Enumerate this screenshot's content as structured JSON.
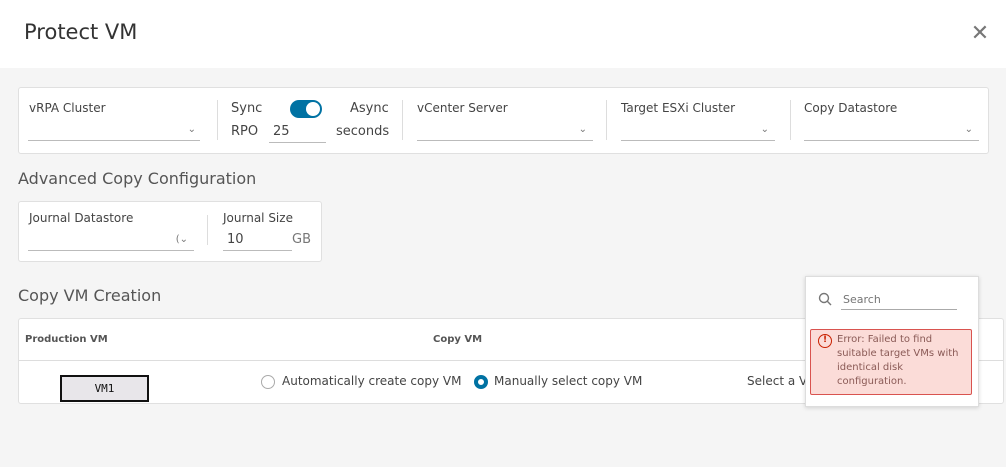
{
  "dialog": {
    "title": "Protect VM",
    "close_icon": "close-icon"
  },
  "replication": {
    "vrpa_cluster": {
      "label": "vRPA Cluster",
      "value": ""
    },
    "sync_label": "Sync",
    "async_label": "Async",
    "mode_toggle_on": true,
    "rpo_label": "RPO",
    "rpo_value": "25",
    "rpo_unit": "seconds",
    "vcenter_server": {
      "label": "vCenter Server",
      "value": ""
    },
    "target_esxi_cluster": {
      "label": "Target ESXi Cluster",
      "value": ""
    },
    "copy_datastore": {
      "label": "Copy Datastore",
      "value": ""
    }
  },
  "advanced": {
    "title": "Advanced Copy Configuration",
    "journal_datastore": {
      "label": "Journal Datastore",
      "value": ""
    },
    "journal_size": {
      "label": "Journal Size",
      "value": "10",
      "unit": "GB"
    }
  },
  "copy_vm_creation": {
    "title": "Copy VM Creation",
    "columns": [
      "Production VM",
      "Copy VM"
    ],
    "rows": [
      {
        "production_vm": "VM1",
        "auto_option": "Automatically create copy VM",
        "manual_option": "Manually select copy VM",
        "selected": "manual",
        "select_placeholder": "Select a V"
      }
    ]
  },
  "popup": {
    "search_placeholder": "Search",
    "error": "Error: Failed to find suitable target VMs with identical disk configuration."
  }
}
